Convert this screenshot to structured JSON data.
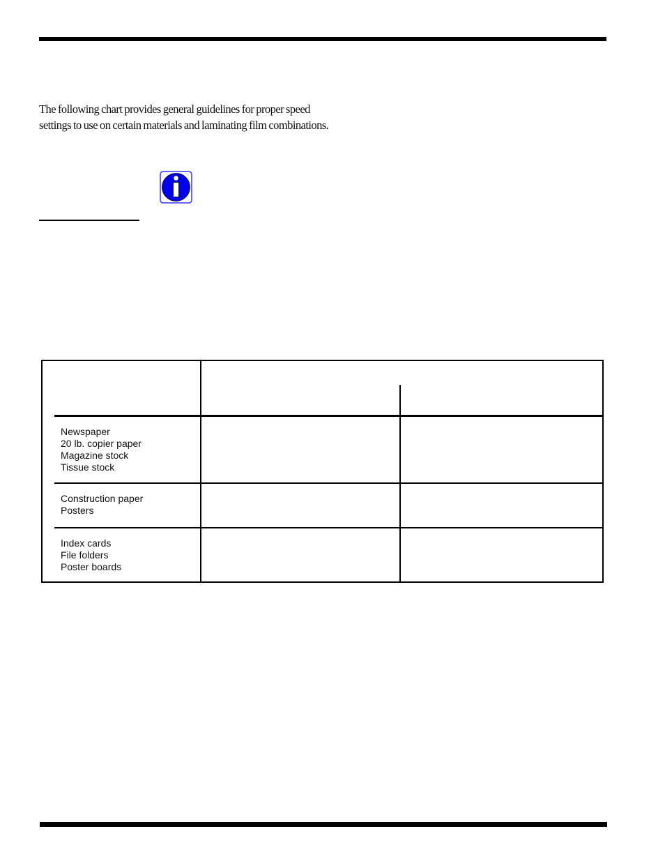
{
  "page": {
    "intro_paragraph": "The following chart provides general guidelines for proper speed settings to use on certain materials and laminating film combinations.",
    "note_icon": "info-icon",
    "colors": {
      "rule": "#000000",
      "info_icon_fill": "#0000ee",
      "info_icon_border": "#3333ff",
      "text": "#111111"
    }
  },
  "table": {
    "header": {
      "material_column": "",
      "speed_group": "",
      "speed_subcolumns": [
        "",
        ""
      ]
    },
    "rows": [
      {
        "materials": [
          "Newspaper",
          "20 lb. copier paper",
          "Magazine stock",
          "Tissue stock"
        ],
        "values": [
          "",
          ""
        ]
      },
      {
        "materials": [
          "Construction paper",
          "Posters"
        ],
        "values": [
          "",
          ""
        ]
      },
      {
        "materials": [
          "Index cards",
          "File folders",
          "Poster boards"
        ],
        "values": [
          "",
          ""
        ]
      }
    ]
  }
}
